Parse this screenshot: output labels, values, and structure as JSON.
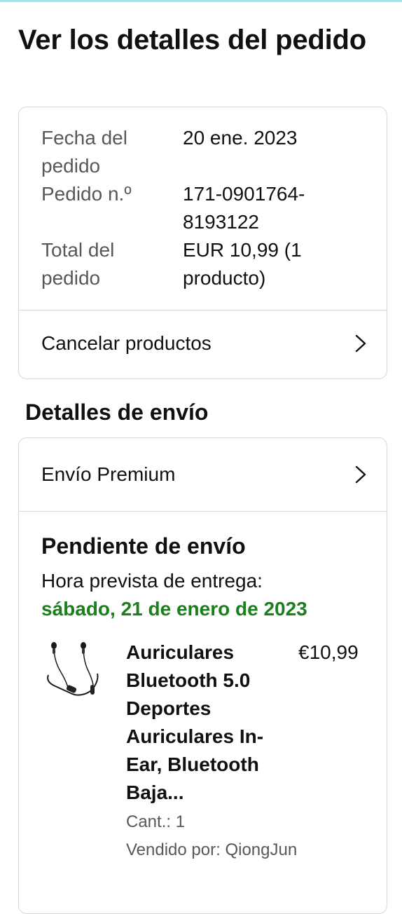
{
  "page": {
    "title": "Ver los detalles del pedido"
  },
  "order_summary": {
    "rows": [
      {
        "label": "Fecha del pedido",
        "value": "20 ene. 2023"
      },
      {
        "label": "Pedido n.º",
        "value": "171-0901764-8193122"
      },
      {
        "label": "Total del pedido",
        "value": "EUR 10,99 (1 producto)"
      }
    ],
    "cancel_label": "Cancelar productos"
  },
  "shipping": {
    "section_title": "Detalles de envío",
    "method_label": "Envío Premium",
    "status": "Pendiente de envío",
    "eta_label": "Hora prevista de entrega:",
    "eta_date": "sábado, 21 de enero de 2023",
    "eta_color": "#1b7f1b",
    "item": {
      "title": "Auriculares Bluetooth 5.0 Deportes Auriculares In-Ear, Bluetooth Baja...",
      "price": "€10,99",
      "quantity": "Cant.: 1",
      "seller": "Vendido por: QiongJun",
      "image_icon": "neckband-earphones-image"
    }
  },
  "icons": {
    "chevron": "chevron-right-icon"
  }
}
